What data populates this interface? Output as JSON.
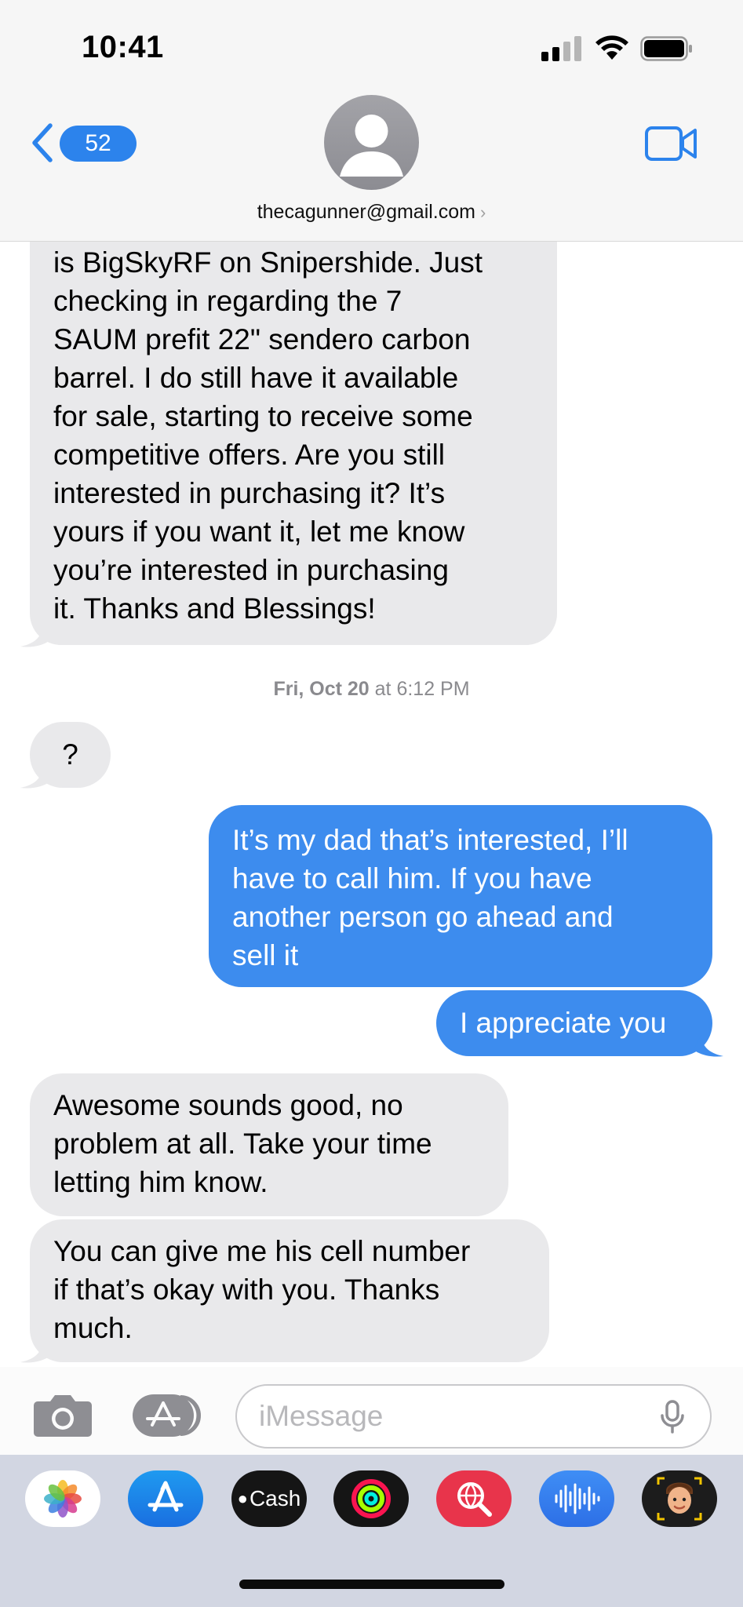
{
  "status_bar": {
    "time": "10:41"
  },
  "header": {
    "back_count": "52",
    "contact": "thecagunner@gmail.com",
    "contact_chevron": "›"
  },
  "messages": [
    {
      "direction": "incoming",
      "text_lines": [
        "is BigSkyRF on Snipershide. Just",
        "checking in regarding the 7",
        "SAUM prefit 22\" sendero carbon",
        "barrel. I do still have it available",
        "for sale, starting to receive some",
        "competitive offers. Are you still",
        "interested in purchasing it? It’s",
        "yours if you want it, let me know",
        "you’re interested in purchasing",
        "it. Thanks and Blessings!"
      ]
    },
    {
      "direction": "incoming",
      "text": "?"
    },
    {
      "direction": "outgoing",
      "text_lines": [
        "It’s my dad that’s interested, I’ll",
        "have to call him. If you have",
        "another person go ahead and",
        "sell it"
      ]
    },
    {
      "direction": "outgoing",
      "text": "I appreciate you"
    },
    {
      "direction": "incoming",
      "text_lines": [
        "Awesome sounds good, no",
        "problem at all. Take your time",
        "letting him know."
      ]
    },
    {
      "direction": "incoming",
      "text_lines": [
        "You can give me his cell number",
        "if that’s okay with you. Thanks",
        "much."
      ]
    }
  ],
  "timestamp": {
    "day": "Fri, Oct 20",
    "time": "at 6:12 PM"
  },
  "input": {
    "placeholder": "iMessage"
  },
  "app_drawer": {
    "apps": [
      {
        "icon": "photos-icon"
      },
      {
        "icon": "app-store-icon"
      },
      {
        "icon": "apple-cash-icon",
        "label": "Cash"
      },
      {
        "icon": "activity-icon"
      },
      {
        "icon": "web-search-icon"
      },
      {
        "icon": "audio-message-icon"
      },
      {
        "icon": "memoji-icon"
      }
    ]
  },
  "colors": {
    "outgoing": "#3d8cee",
    "incoming": "#e9e9eb",
    "accent": "#2c83ec"
  }
}
